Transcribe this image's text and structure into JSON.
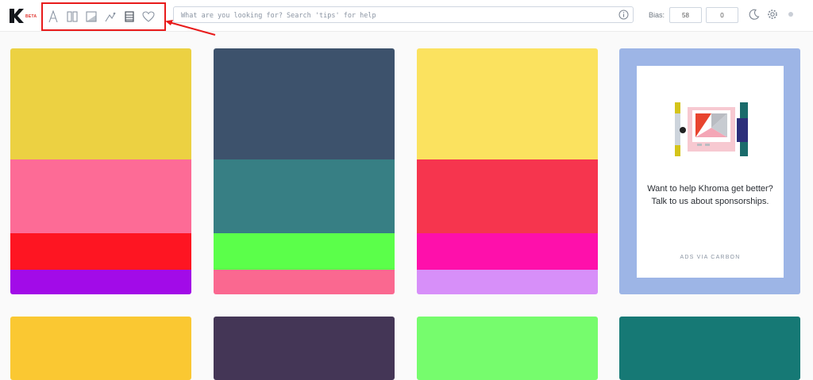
{
  "header": {
    "beta": "BETA",
    "search": {
      "placeholder": "What are you looking for? Search 'tips' for help",
      "value": ""
    },
    "bias_label": "Bias:",
    "bias_values": [
      "58",
      "0"
    ]
  },
  "toolbar": {
    "tools": [
      "type-icon",
      "columns-icon",
      "gradient-icon",
      "palette-pick-icon",
      "swatch-list-icon",
      "heart-icon"
    ],
    "highlight_color": "#e81b1b"
  },
  "palettes": [
    {
      "colors": [
        "#ecd142",
        "#fd6b96",
        "#fe1522",
        "#a20be8"
      ],
      "weights": [
        45,
        30,
        15,
        10
      ]
    },
    {
      "colors": [
        "#3d526c",
        "#377f84",
        "#5bff4a",
        "#fa6890"
      ],
      "weights": [
        45,
        30,
        15,
        10
      ]
    },
    {
      "colors": [
        "#fbe25f",
        "#f6354e",
        "#fe10ab",
        "#d78ff9"
      ],
      "weights": [
        45,
        30,
        15,
        10
      ]
    },
    {
      "colors": [
        "#fac832"
      ]
    },
    {
      "colors": [
        "#443656"
      ]
    },
    {
      "colors": [
        "#76fc6d"
      ]
    },
    {
      "colors": [
        "#167975"
      ]
    }
  ],
  "ad": {
    "text": "Want to help Khroma get better? Talk to us about sponsorships.",
    "via": "ADS VIA CARBON",
    "background": "#9db5e6"
  }
}
